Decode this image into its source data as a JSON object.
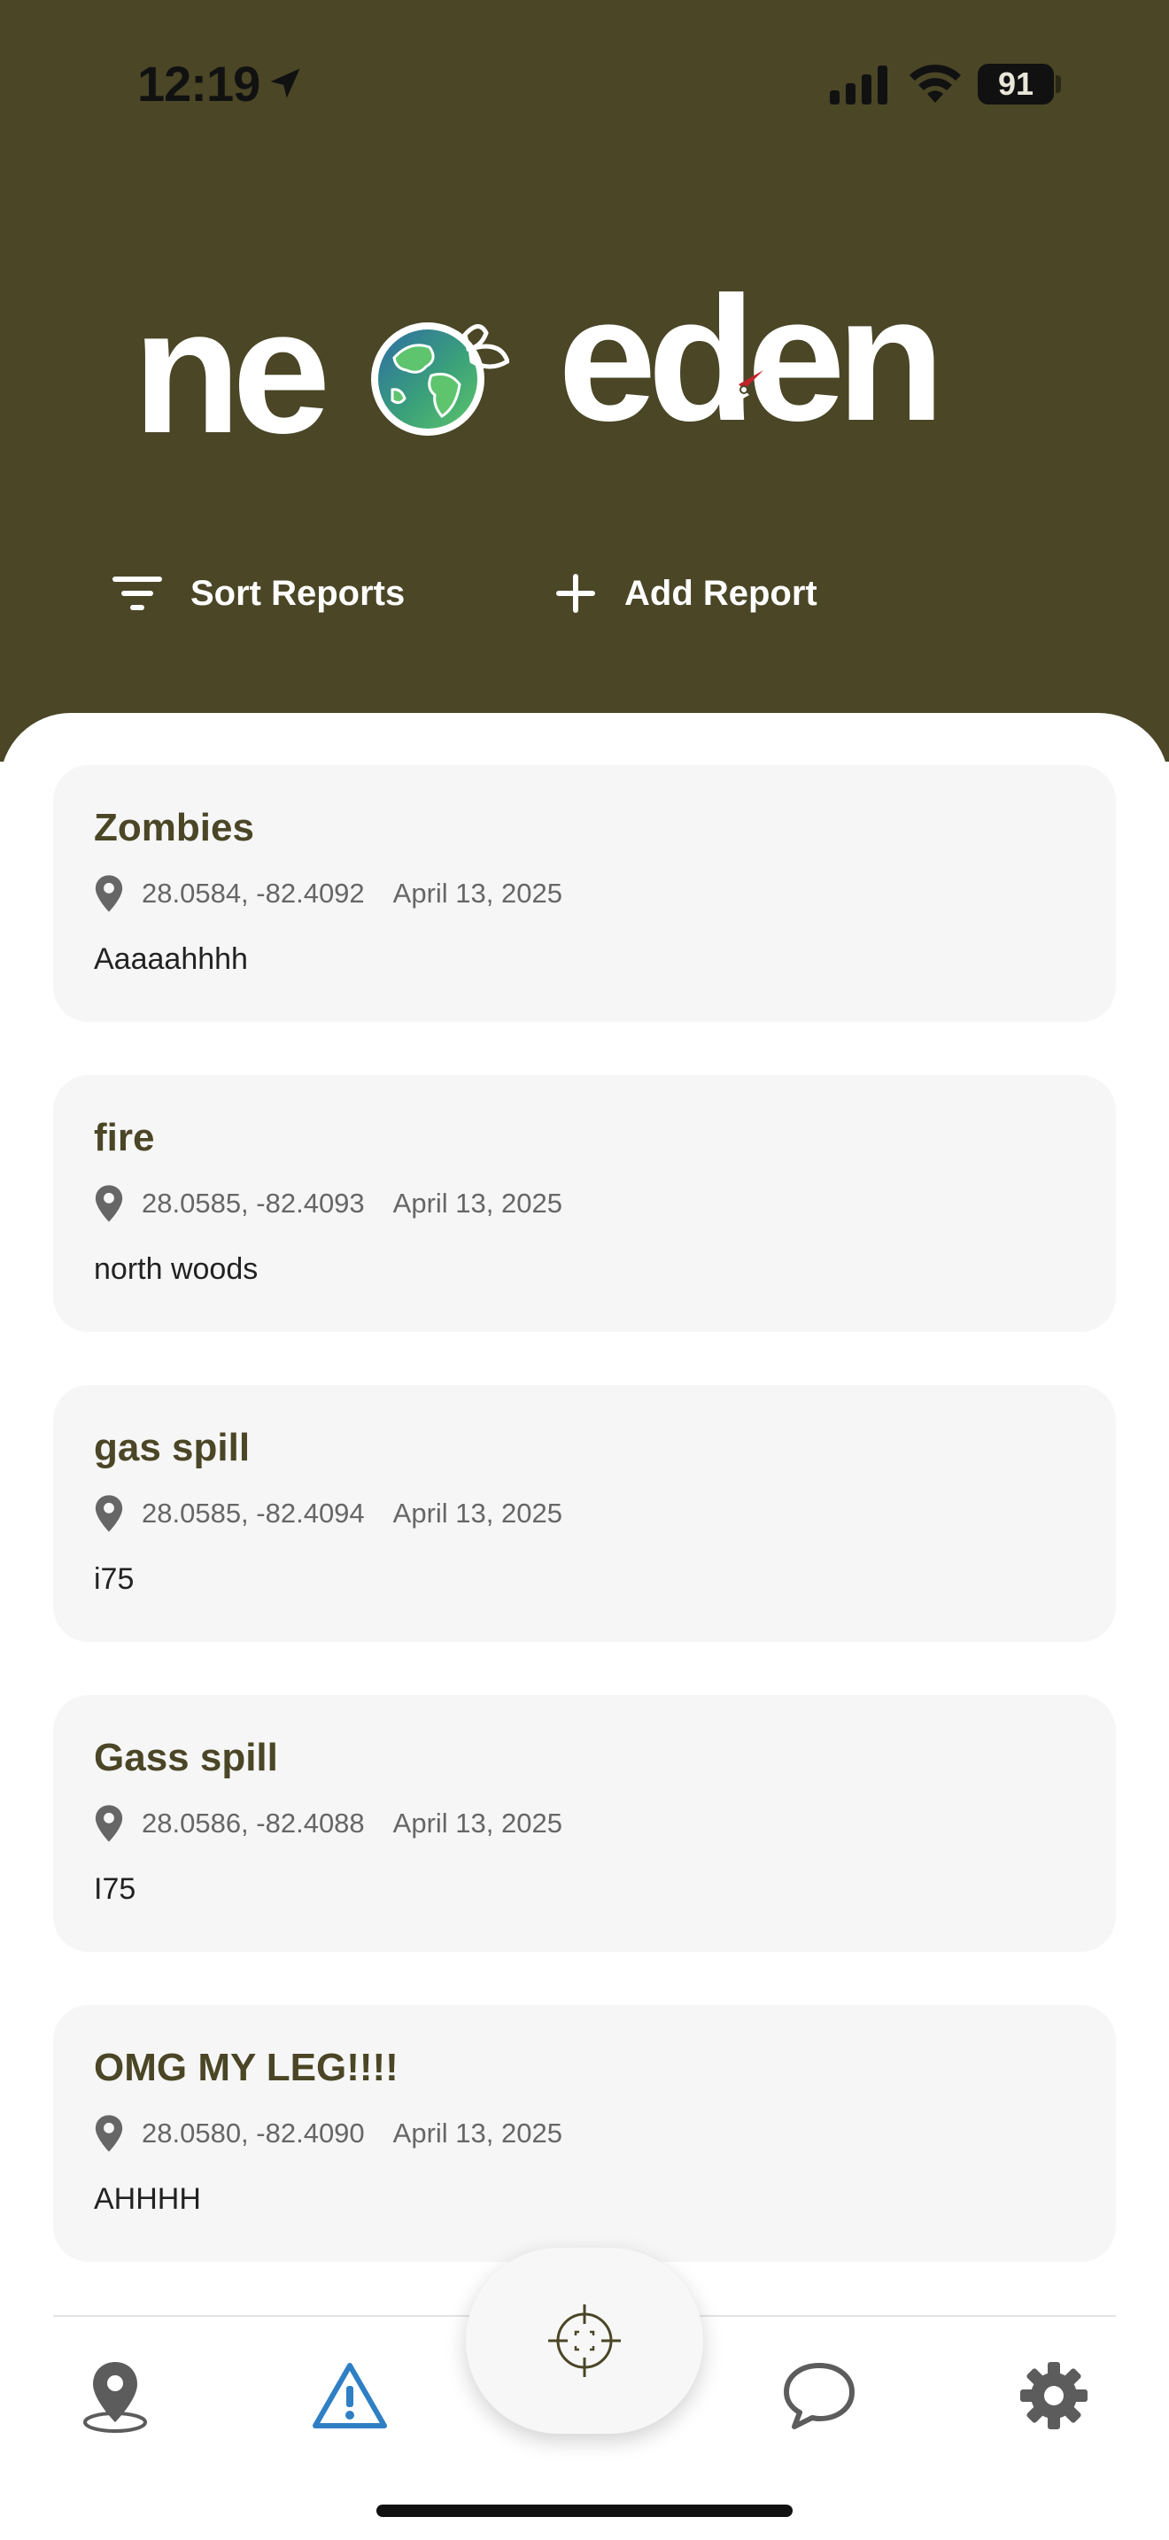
{
  "status_bar": {
    "time": "12:19",
    "battery": "91",
    "icons": [
      "location-arrow-icon",
      "cellular-signal-icon",
      "wifi-icon",
      "battery-icon"
    ]
  },
  "header": {
    "logo_part1": "ne",
    "logo_part2": "eden",
    "logo_letter_o": "o",
    "sort_label": "Sort Reports",
    "add_label": "Add Report",
    "background_color": "#4a4626"
  },
  "reports": [
    {
      "title": "Zombies",
      "coords": "28.0584, -82.4092",
      "date": "April 13, 2025",
      "description": "Aaaaahhhh"
    },
    {
      "title": "fire",
      "coords": "28.0585, -82.4093",
      "date": "April 13, 2025",
      "description": "north woods"
    },
    {
      "title": "gas spill",
      "coords": "28.0585, -82.4094",
      "date": "April 13, 2025",
      "description": "i75"
    },
    {
      "title": "Gass spill",
      "coords": "28.0586, -82.4088",
      "date": "April 13, 2025",
      "description": "I75"
    },
    {
      "title": "OMG MY LEG!!!!",
      "coords": "28.0580, -82.4090",
      "date": "April 13, 2025",
      "description": "AHHHH"
    }
  ],
  "bottom_nav": {
    "items": [
      "map-pin-icon",
      "warning-icon",
      "crosshair-icon",
      "chat-bubble-icon",
      "gear-icon"
    ],
    "active": "warning-icon",
    "active_color": "#2f7fc4"
  }
}
